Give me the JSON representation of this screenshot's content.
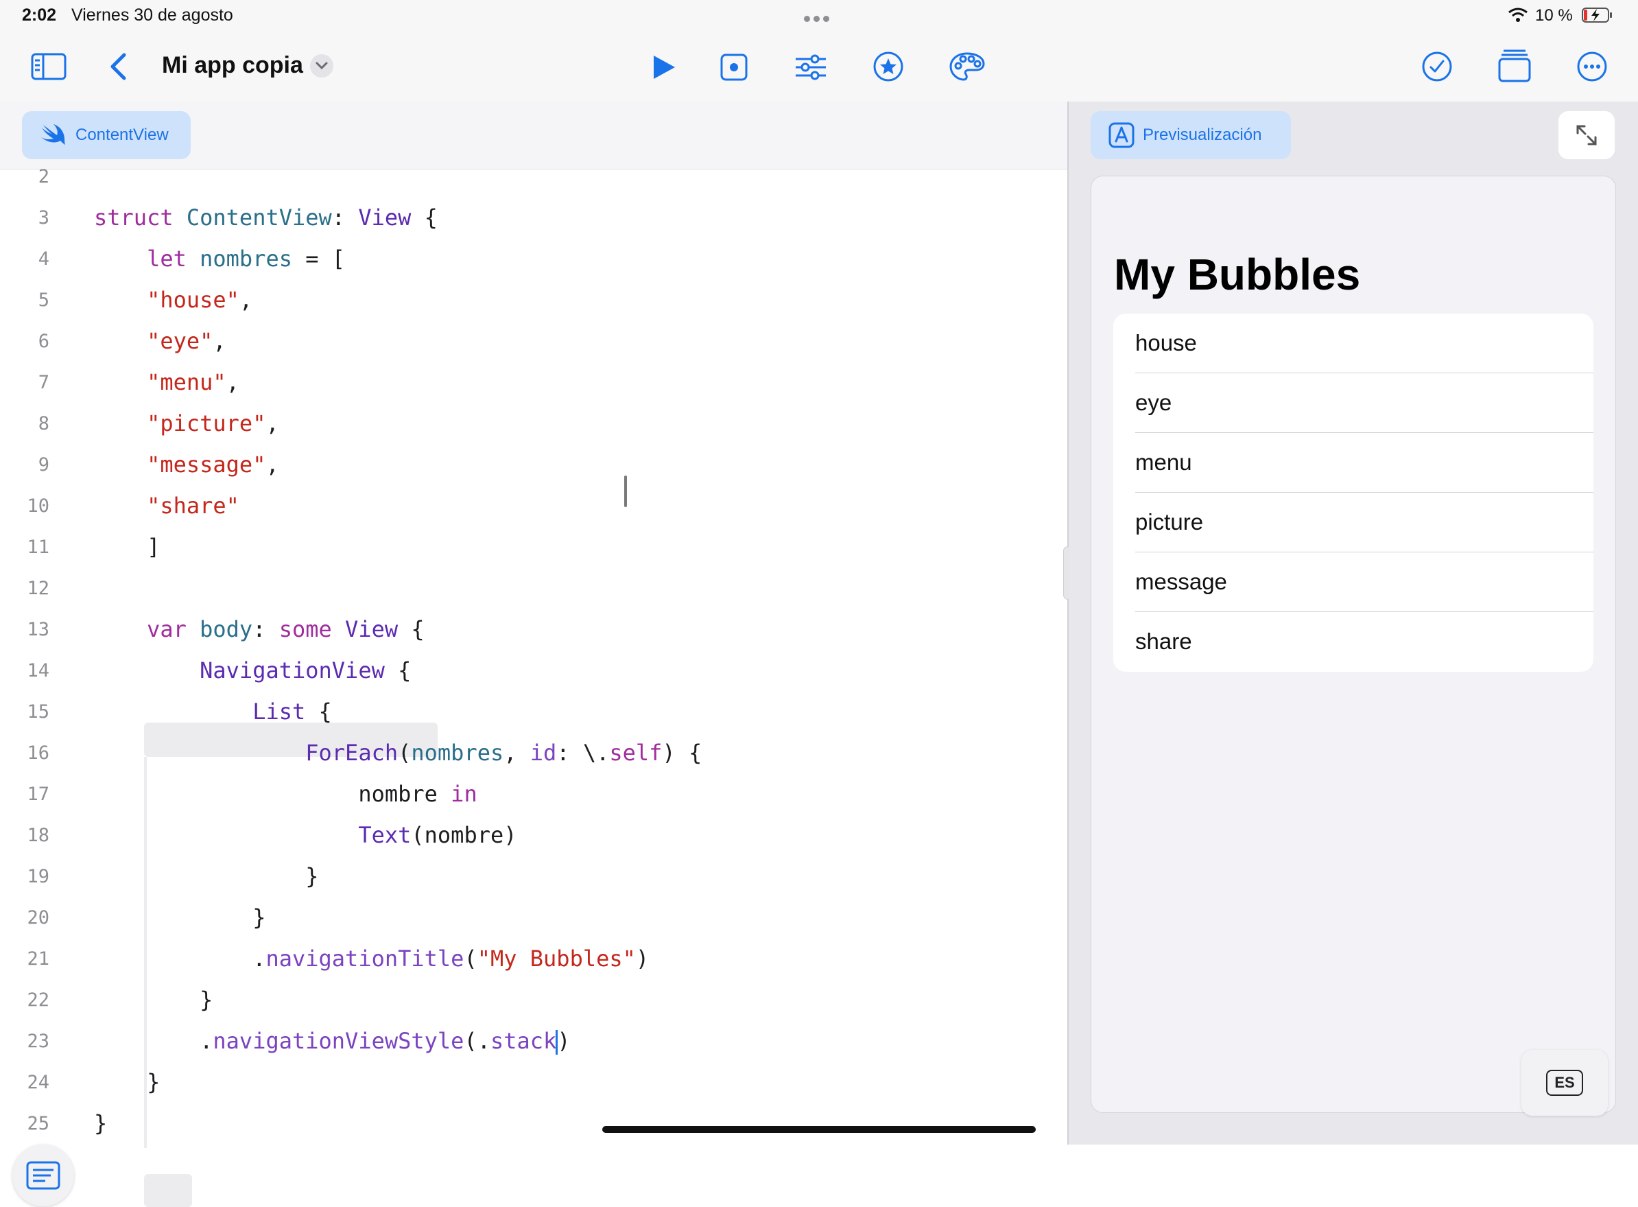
{
  "status_bar": {
    "time": "2:02",
    "date": "Viernes 30 de agosto",
    "battery_percent": "10 %"
  },
  "toolbar": {
    "project_title": "Mi app copia",
    "icons": [
      "sidebar-icon",
      "back-icon",
      "play-icon",
      "stop-icon",
      "settings-sliders-icon",
      "star-icon",
      "palette-icon",
      "checkmark-icon",
      "multiwindow-icon",
      "more-icon"
    ]
  },
  "editor": {
    "file_tab_label": "ContentView",
    "lines": [
      {
        "n": "2",
        "tokens": []
      },
      {
        "n": "3",
        "tokens": [
          [
            "kw",
            "struct"
          ],
          [
            "",
            ""
          ],
          [
            "nm",
            " ContentView"
          ],
          [
            "",
            ": "
          ],
          [
            "ty",
            "View"
          ],
          [
            "",
            " {"
          ]
        ]
      },
      {
        "n": "4",
        "tokens": [
          [
            "",
            "    "
          ],
          [
            "kw",
            "let"
          ],
          [
            "nm",
            " nombres"
          ],
          [
            "",
            " = ["
          ]
        ]
      },
      {
        "n": "5",
        "tokens": [
          [
            "",
            "    "
          ],
          [
            "st",
            "\"house\""
          ],
          [
            "",
            ","
          ]
        ]
      },
      {
        "n": "6",
        "tokens": [
          [
            "",
            "    "
          ],
          [
            "st",
            "\"eye\""
          ],
          [
            "",
            ","
          ]
        ]
      },
      {
        "n": "7",
        "tokens": [
          [
            "",
            "    "
          ],
          [
            "st",
            "\"menu\""
          ],
          [
            "",
            ","
          ]
        ]
      },
      {
        "n": "8",
        "tokens": [
          [
            "",
            "    "
          ],
          [
            "st",
            "\"picture\""
          ],
          [
            "",
            ","
          ]
        ]
      },
      {
        "n": "9",
        "tokens": [
          [
            "",
            "    "
          ],
          [
            "st",
            "\"message\""
          ],
          [
            "",
            ","
          ]
        ]
      },
      {
        "n": "10",
        "tokens": [
          [
            "",
            "    "
          ],
          [
            "st",
            "\"share\""
          ]
        ]
      },
      {
        "n": "11",
        "tokens": [
          [
            "",
            "    ]"
          ]
        ]
      },
      {
        "n": "12",
        "tokens": []
      },
      {
        "n": "13",
        "tokens": [
          [
            "",
            "    "
          ],
          [
            "kw",
            "var"
          ],
          [
            "nm",
            " body"
          ],
          [
            "",
            ": "
          ],
          [
            "kw",
            "some"
          ],
          [
            "ty",
            " View"
          ],
          [
            "",
            " {"
          ]
        ]
      },
      {
        "n": "14",
        "tokens": [
          [
            "",
            "        "
          ],
          [
            "ty",
            "NavigationView"
          ],
          [
            "",
            " {"
          ]
        ]
      },
      {
        "n": "15",
        "tokens": [
          [
            "",
            "            "
          ],
          [
            "ty",
            "List"
          ],
          [
            "",
            " {"
          ]
        ]
      },
      {
        "n": "16",
        "tokens": [
          [
            "",
            "                "
          ],
          [
            "ty",
            "ForEach"
          ],
          [
            "",
            "("
          ],
          [
            "nm",
            "nombres"
          ],
          [
            "",
            ", "
          ],
          [
            "md",
            "id"
          ],
          [
            "",
            ": \\."
          ],
          [
            "kw",
            "self"
          ],
          [
            "",
            ") {"
          ]
        ]
      },
      {
        "n": "17",
        "tokens": [
          [
            "",
            "                    nombre "
          ],
          [
            "kw",
            "in"
          ]
        ]
      },
      {
        "n": "18",
        "tokens": [
          [
            "",
            "                    "
          ],
          [
            "ty",
            "Text"
          ],
          [
            "",
            "(nombre)"
          ]
        ]
      },
      {
        "n": "19",
        "tokens": [
          [
            "",
            "                }"
          ]
        ]
      },
      {
        "n": "20",
        "tokens": [
          [
            "",
            "            }"
          ]
        ]
      },
      {
        "n": "21",
        "tokens": [
          [
            "",
            "            ."
          ],
          [
            "md",
            "navigationTitle"
          ],
          [
            "",
            "("
          ],
          [
            "st",
            "\"My Bubbles\""
          ],
          [
            "",
            ")"
          ]
        ]
      },
      {
        "n": "22",
        "tokens": [
          [
            "",
            "        }"
          ]
        ]
      },
      {
        "n": "23",
        "tokens": [
          [
            "",
            "        ."
          ],
          [
            "md",
            "navigationViewStyle"
          ],
          [
            "",
            "(."
          ],
          [
            "md",
            "stack"
          ],
          [
            "",
            ")"
          ]
        ]
      },
      {
        "n": "24",
        "tokens": [
          [
            "",
            "    }"
          ]
        ]
      },
      {
        "n": "25",
        "tokens": [
          [
            "",
            "}"
          ]
        ]
      }
    ]
  },
  "preview": {
    "tab_label": "Previsualización",
    "nav_title": "My Bubbles",
    "items": [
      "house",
      "eye",
      "menu",
      "picture",
      "message",
      "share"
    ],
    "keyboard_label": "ES"
  },
  "colors": {
    "accent": "#1a73e8",
    "keyword": "#a02d9e",
    "type": "#5b2bb0",
    "string": "#c4271b"
  }
}
